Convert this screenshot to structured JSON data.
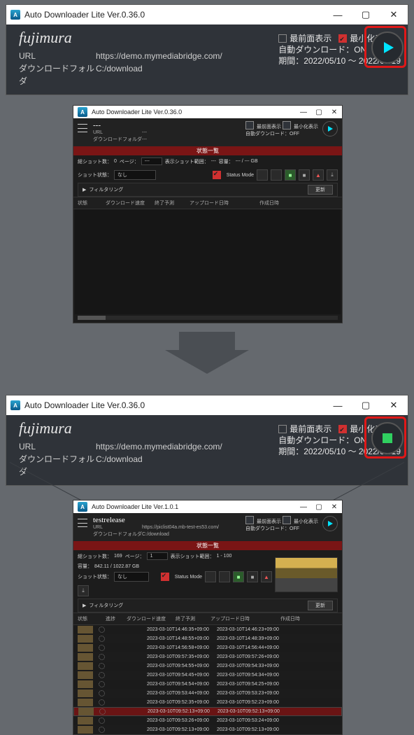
{
  "app": {
    "title": "Auto Downloader Lite Ver.0.36.0",
    "title_small2": "Auto Downloader Lite Ver.0.36.0",
    "title_small3": "Auto Downloader Lite Ver.1.0.1"
  },
  "hdr": {
    "username": "fujimura",
    "url_label": "URL",
    "url_value": "https://demo.mymediabridge.com/",
    "folder_label": "ダウンロードフォルダ",
    "folder_value": "C:/download",
    "chk_topmost": "最前面表示",
    "chk_minimized": "最小化表示",
    "auto_dl": "自動ダウンロード：ON",
    "period": "期間：2022/05/10 ～ 2022/05/19"
  },
  "small1": {
    "username": "---",
    "url": "---",
    "folder": "---",
    "auto_dl": "自動ダウンロード：OFF",
    "list_title": "状態一覧",
    "totalshots_lbl": "総ショット数：",
    "totalshots_val": "0",
    "page_lbl": "ページ：",
    "page_val": "---",
    "range_lbl": "表示ショット範囲：",
    "range_val": "---",
    "cap_lbl": "容量：",
    "cap_val": "--- / --- GB",
    "shotstate_lbl": "ショット状態：",
    "shotstate_val": "なし",
    "status_mode": "Status Mode",
    "filter": "フィルタリング",
    "update": "更新",
    "col_state": "状態",
    "col_speed": "ダウンロード速度",
    "col_end": "終了予測",
    "col_upload": "アップロード日時",
    "col_created": "作成日時"
  },
  "small2": {
    "username": "testrelease",
    "url": "https://piclist04a.mb-test-es53.com/",
    "folder": "C:/download",
    "totalshots_val": "169",
    "page_val": "1",
    "range_val": "1 - 100",
    "cap_val": "842.11 / 1022.87 GB",
    "col_prog": "進捗"
  },
  "rows": [
    {
      "up": "2023-03-10T14:46:35+09:00",
      "cr": "2023-03-10T14:46:23+09:00"
    },
    {
      "up": "2023-03-10T14:48:55+09:00",
      "cr": "2023-03-10T14:48:39+09:00"
    },
    {
      "up": "2023-03-10T14:56:58+09:00",
      "cr": "2023-03-10T14:56:44+09:00"
    },
    {
      "up": "2023-03-10T09:57:35+09:00",
      "cr": "2023-03-10T09:57:26+09:00"
    },
    {
      "up": "2023-03-10T09:54:55+09:00",
      "cr": "2023-03-10T09:54:33+09:00"
    },
    {
      "up": "2023-03-10T09:54:45+09:00",
      "cr": "2023-03-10T09:54:34+09:00"
    },
    {
      "up": "2023-03-10T09:54:54+09:00",
      "cr": "2023-03-10T09:54:25+09:00"
    },
    {
      "up": "2023-03-10T09:53:44+09:00",
      "cr": "2023-03-10T09:53:23+09:00"
    },
    {
      "up": "2023-03-10T09:52:35+09:00",
      "cr": "2023-03-10T09:52:23+09:00"
    },
    {
      "up": "2023-03-10T09:52:13+09:00",
      "cr": "2023-03-10T09:52:13+09:00"
    },
    {
      "up": "2023-03-10T09:53:26+09:00",
      "cr": "2023-03-10T09:53:24+09:00"
    },
    {
      "up": "2023-03-10T09:52:13+09:00",
      "cr": "2023-03-10T09:52:13+09:00"
    }
  ]
}
